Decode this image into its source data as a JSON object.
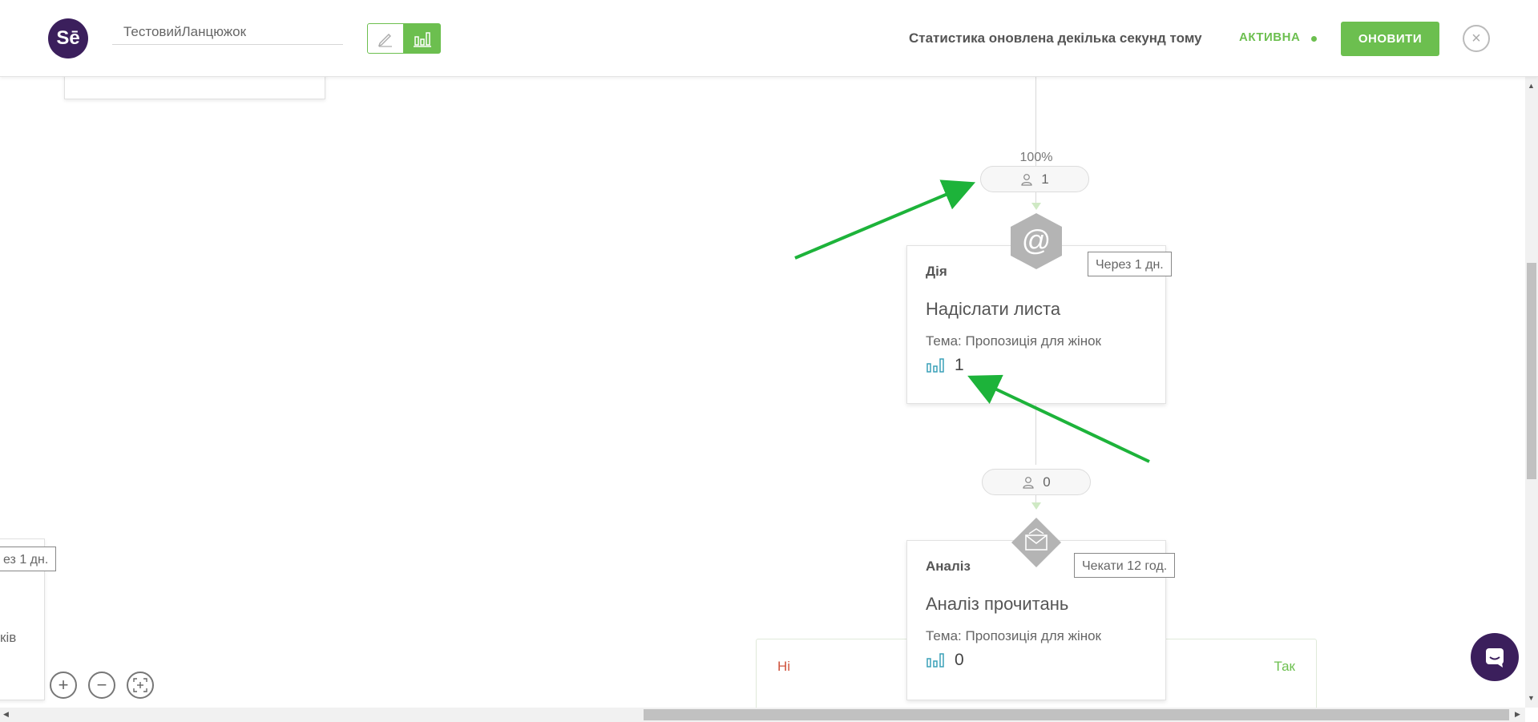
{
  "header": {
    "logo_text": "Sē",
    "chain_name": "ТестовийЛанцюжок",
    "status_text": "Статистика оновлена декілька секунд тому",
    "active_label": "АКТИВНА",
    "refresh_label": "ОНОВИТИ",
    "close_symbol": "×"
  },
  "flow": {
    "entry": {
      "percent": "100%",
      "count": "1"
    },
    "action_card": {
      "type": "Дія",
      "title": "Надіслати листа",
      "subject": "Тема: Пропозиція для жінок",
      "stat_value": "1",
      "delay": "Через 1 дн.",
      "icon": "at-sign-icon"
    },
    "waiting": {
      "count": "0"
    },
    "analysis_card": {
      "type": "Аналіз",
      "title": "Аналіз прочитань",
      "subject": "Тема: Пропозиція для жінок",
      "stat_value": "0",
      "delay": "Чекати 12 год.",
      "icon": "envelope-open-icon"
    },
    "split": {
      "no_label": "Ні",
      "yes_label": "Так"
    },
    "left_partial": {
      "delay": "ез 1 дн.",
      "text": "ків"
    }
  },
  "zoom": {
    "in": "+",
    "out": "−"
  },
  "colors": {
    "accent": "#6cbf4f",
    "brand": "#3b1f5c",
    "negative": "#d0543e",
    "stats_icon": "#3aa0b8",
    "annotation_arrow": "#1db33a"
  }
}
